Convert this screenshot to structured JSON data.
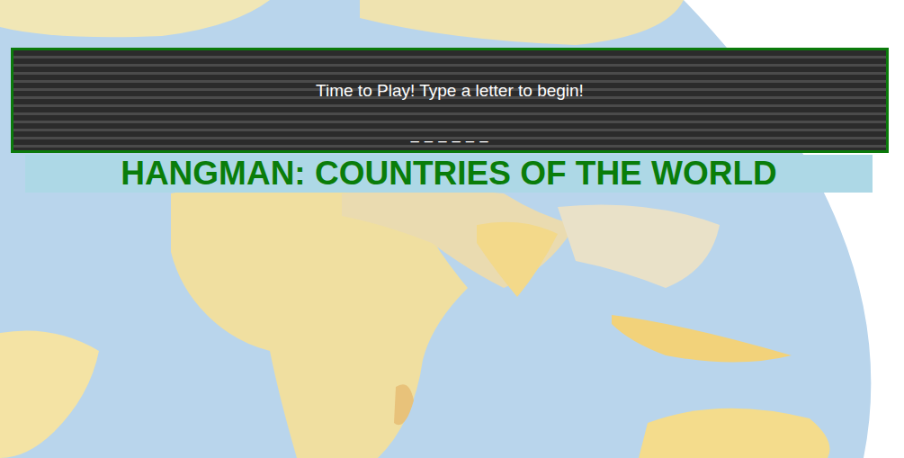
{
  "game": {
    "message": "Time to Play! Type a letter to begin!",
    "blanks": "_ _ _ _ _ _"
  },
  "title": "HANGMAN: COUNTRIES OF THE WORLD"
}
